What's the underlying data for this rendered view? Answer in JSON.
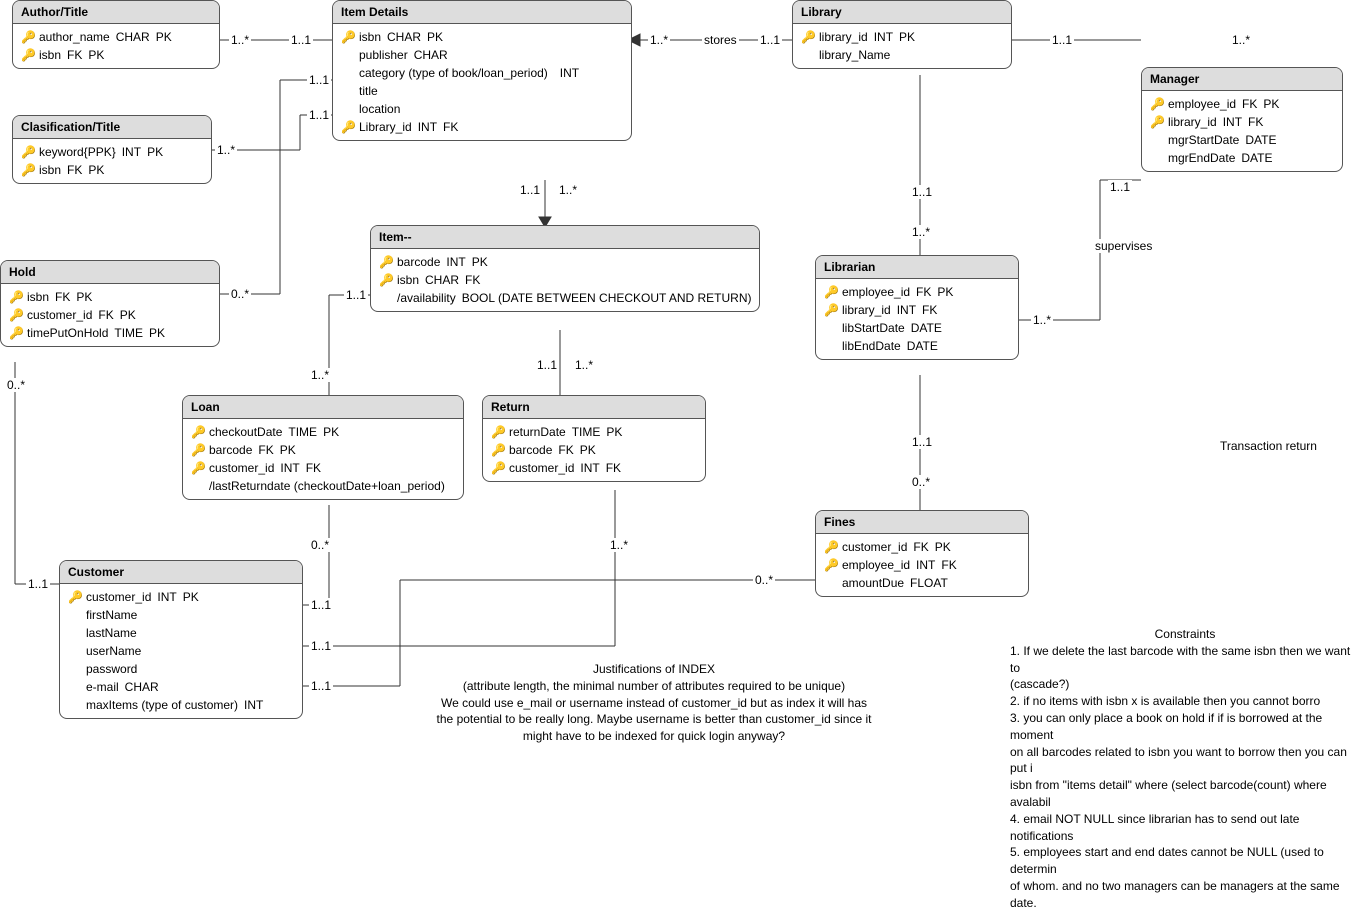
{
  "entities": {
    "author_title": {
      "title": "Author/Title",
      "attrs": [
        {
          "key": "gold",
          "name": "author_name",
          "type": "CHAR",
          "constraint": "PK"
        },
        {
          "key": "gold",
          "name": "isbn",
          "type": "FK",
          "constraint": "PK"
        }
      ]
    },
    "classification_title": {
      "title": "Clasification/Title",
      "attrs": [
        {
          "key": "gold",
          "name": "keyword{PPK}",
          "type": "INT",
          "constraint": "PK"
        },
        {
          "key": "gold",
          "name": "isbn",
          "type": "FK",
          "constraint": "PK"
        }
      ]
    },
    "item_details": {
      "title": "Item Details",
      "attrs": [
        {
          "key": "gold",
          "name": "isbn",
          "type": "CHAR",
          "constraint": "PK"
        },
        {
          "key": "none",
          "name": "publisher",
          "type": "CHAR",
          "constraint": ""
        },
        {
          "key": "none",
          "name": "category (type of book/loan_period)",
          "type": "",
          "constraint": "INT"
        },
        {
          "key": "none",
          "name": "title",
          "type": "",
          "constraint": ""
        },
        {
          "key": "none",
          "name": "location",
          "type": "",
          "constraint": ""
        },
        {
          "key": "grey",
          "name": "Library_id",
          "type": "INT",
          "constraint": "FK"
        }
      ]
    },
    "library": {
      "title": "Library",
      "attrs": [
        {
          "key": "gold",
          "name": "library_id",
          "type": "INT",
          "constraint": "PK"
        },
        {
          "key": "none",
          "name": "library_Name",
          "type": "",
          "constraint": ""
        }
      ]
    },
    "manager": {
      "title": "Manager",
      "attrs": [
        {
          "key": "gold",
          "name": "employee_id",
          "type": "FK",
          "constraint": "PK"
        },
        {
          "key": "grey",
          "name": "library_id",
          "type": "INT",
          "constraint": "FK"
        },
        {
          "key": "none",
          "name": "mgrStartDate",
          "type": "DATE",
          "constraint": ""
        },
        {
          "key": "none",
          "name": "mgrEndDate",
          "type": "DATE",
          "constraint": ""
        }
      ]
    },
    "hold": {
      "title": "Hold",
      "attrs": [
        {
          "key": "gold",
          "name": "isbn",
          "type": "FK",
          "constraint": "PK"
        },
        {
          "key": "gold",
          "name": "customer_id",
          "type": "FK",
          "constraint": "PK"
        },
        {
          "key": "gold",
          "name": "timePutOnHold",
          "type": "TIME",
          "constraint": "PK"
        }
      ]
    },
    "item": {
      "title": "Item--",
      "attrs": [
        {
          "key": "gold",
          "name": "barcode",
          "type": "INT",
          "constraint": "PK"
        },
        {
          "key": "grey",
          "name": "isbn",
          "type": "CHAR",
          "constraint": "FK"
        },
        {
          "key": "none",
          "name": "/availability",
          "type": "",
          "constraint": "BOOL (DATE BETWEEN CHECKOUT AND RETURN)"
        }
      ]
    },
    "librarian": {
      "title": "Librarian",
      "attrs": [
        {
          "key": "gold",
          "name": "employee_id",
          "type": "FK",
          "constraint": "PK"
        },
        {
          "key": "grey",
          "name": "library_id",
          "type": "INT",
          "constraint": "FK"
        },
        {
          "key": "none",
          "name": "libStartDate",
          "type": "DATE",
          "constraint": ""
        },
        {
          "key": "none",
          "name": "libEndDate",
          "type": "DATE",
          "constraint": ""
        }
      ]
    },
    "loan": {
      "title": "Loan",
      "attrs": [
        {
          "key": "gold",
          "name": "checkoutDate",
          "type": "TIME",
          "constraint": "PK"
        },
        {
          "key": "gold",
          "name": "barcode",
          "type": "FK",
          "constraint": "PK"
        },
        {
          "key": "grey",
          "name": "customer_id",
          "type": "INT",
          "constraint": "FK"
        },
        {
          "key": "none",
          "name": "/lastReturndate (checkoutDate+loan_period)",
          "type": "",
          "constraint": ""
        }
      ]
    },
    "return": {
      "title": "Return",
      "attrs": [
        {
          "key": "gold",
          "name": "returnDate",
          "type": "TIME",
          "constraint": "PK"
        },
        {
          "key": "gold",
          "name": "barcode",
          "type": "FK",
          "constraint": "PK"
        },
        {
          "key": "grey",
          "name": "customer_id",
          "type": "INT",
          "constraint": "FK"
        }
      ]
    },
    "customer": {
      "title": "Customer",
      "attrs": [
        {
          "key": "gold",
          "name": "customer_id",
          "type": "INT",
          "constraint": "PK"
        },
        {
          "key": "none",
          "name": "firstName",
          "type": "",
          "constraint": ""
        },
        {
          "key": "none",
          "name": "lastName",
          "type": "",
          "constraint": ""
        },
        {
          "key": "none",
          "name": "userName",
          "type": "",
          "constraint": ""
        },
        {
          "key": "none",
          "name": "password",
          "type": "",
          "constraint": ""
        },
        {
          "key": "none",
          "name": "e-mail",
          "type": "CHAR",
          "constraint": ""
        },
        {
          "key": "none",
          "name": "maxItems (type of customer)",
          "type": "",
          "constraint": "INT"
        }
      ]
    },
    "fines": {
      "title": "Fines",
      "attrs": [
        {
          "key": "gold",
          "name": "customer_id",
          "type": "FK",
          "constraint": "PK"
        },
        {
          "key": "grey",
          "name": "employee_id",
          "type": "INT",
          "constraint": "FK"
        },
        {
          "key": "none",
          "name": "amountDue",
          "type": "FLOAT",
          "constraint": ""
        }
      ]
    }
  },
  "labels": {
    "l1": "1..*",
    "l2": "1..1",
    "l3": "1..*",
    "l4": "1..1",
    "l5": "1..1",
    "l6": "0..*",
    "l7": "1..1",
    "l8": "1..*",
    "l9": "stores",
    "l10": "1..1",
    "l11": "1..1",
    "l12": "1..*",
    "l13": "1..1",
    "l14": "1..*",
    "l15": "1..1",
    "l16": "1..*",
    "l17": "1..1",
    "l18": "1..*",
    "l19": "1..1",
    "l20": "0..*",
    "l21": "supervises",
    "l22": "1..1",
    "l23": "1..*",
    "l24": "0..*",
    "l25": "0..*",
    "l26": "1..1",
    "l27": "1..1",
    "l28": "1..1",
    "l29": "1..*",
    "l30": "1..1",
    "l31": "Transaction return",
    "l32": "0..*"
  },
  "notes": {
    "justifications_title": "Justifications of INDEX",
    "justifications_body": "(attribute length, the  minimal  number  of  attributes  required to be unique)\nWe could use e_mail or username instead of customer_id but as index it will has\nthe potential to be really long. Maybe username is better than customer_id since it\nmight have to be indexed for quick login anyway?",
    "constraints_title": "Constraints",
    "constraints_body": "1. If we delete the last barcode with the same isbn then we want to\n(cascade?)\n2. if no items with isbn x is available then you cannot borro\n3. you can only place a book on hold if if is borrowed at the moment\non all barcodes related to isbn you want to borrow then you can put i\nisbn from \"items detail\" where (select barcode(count) where avalabil\n4. email NOT NULL since librarian has to send out late notifications\n5. employees start and end dates cannot be NULL (used to determin\nof whom. and no two managers can be managers at the same date."
  }
}
